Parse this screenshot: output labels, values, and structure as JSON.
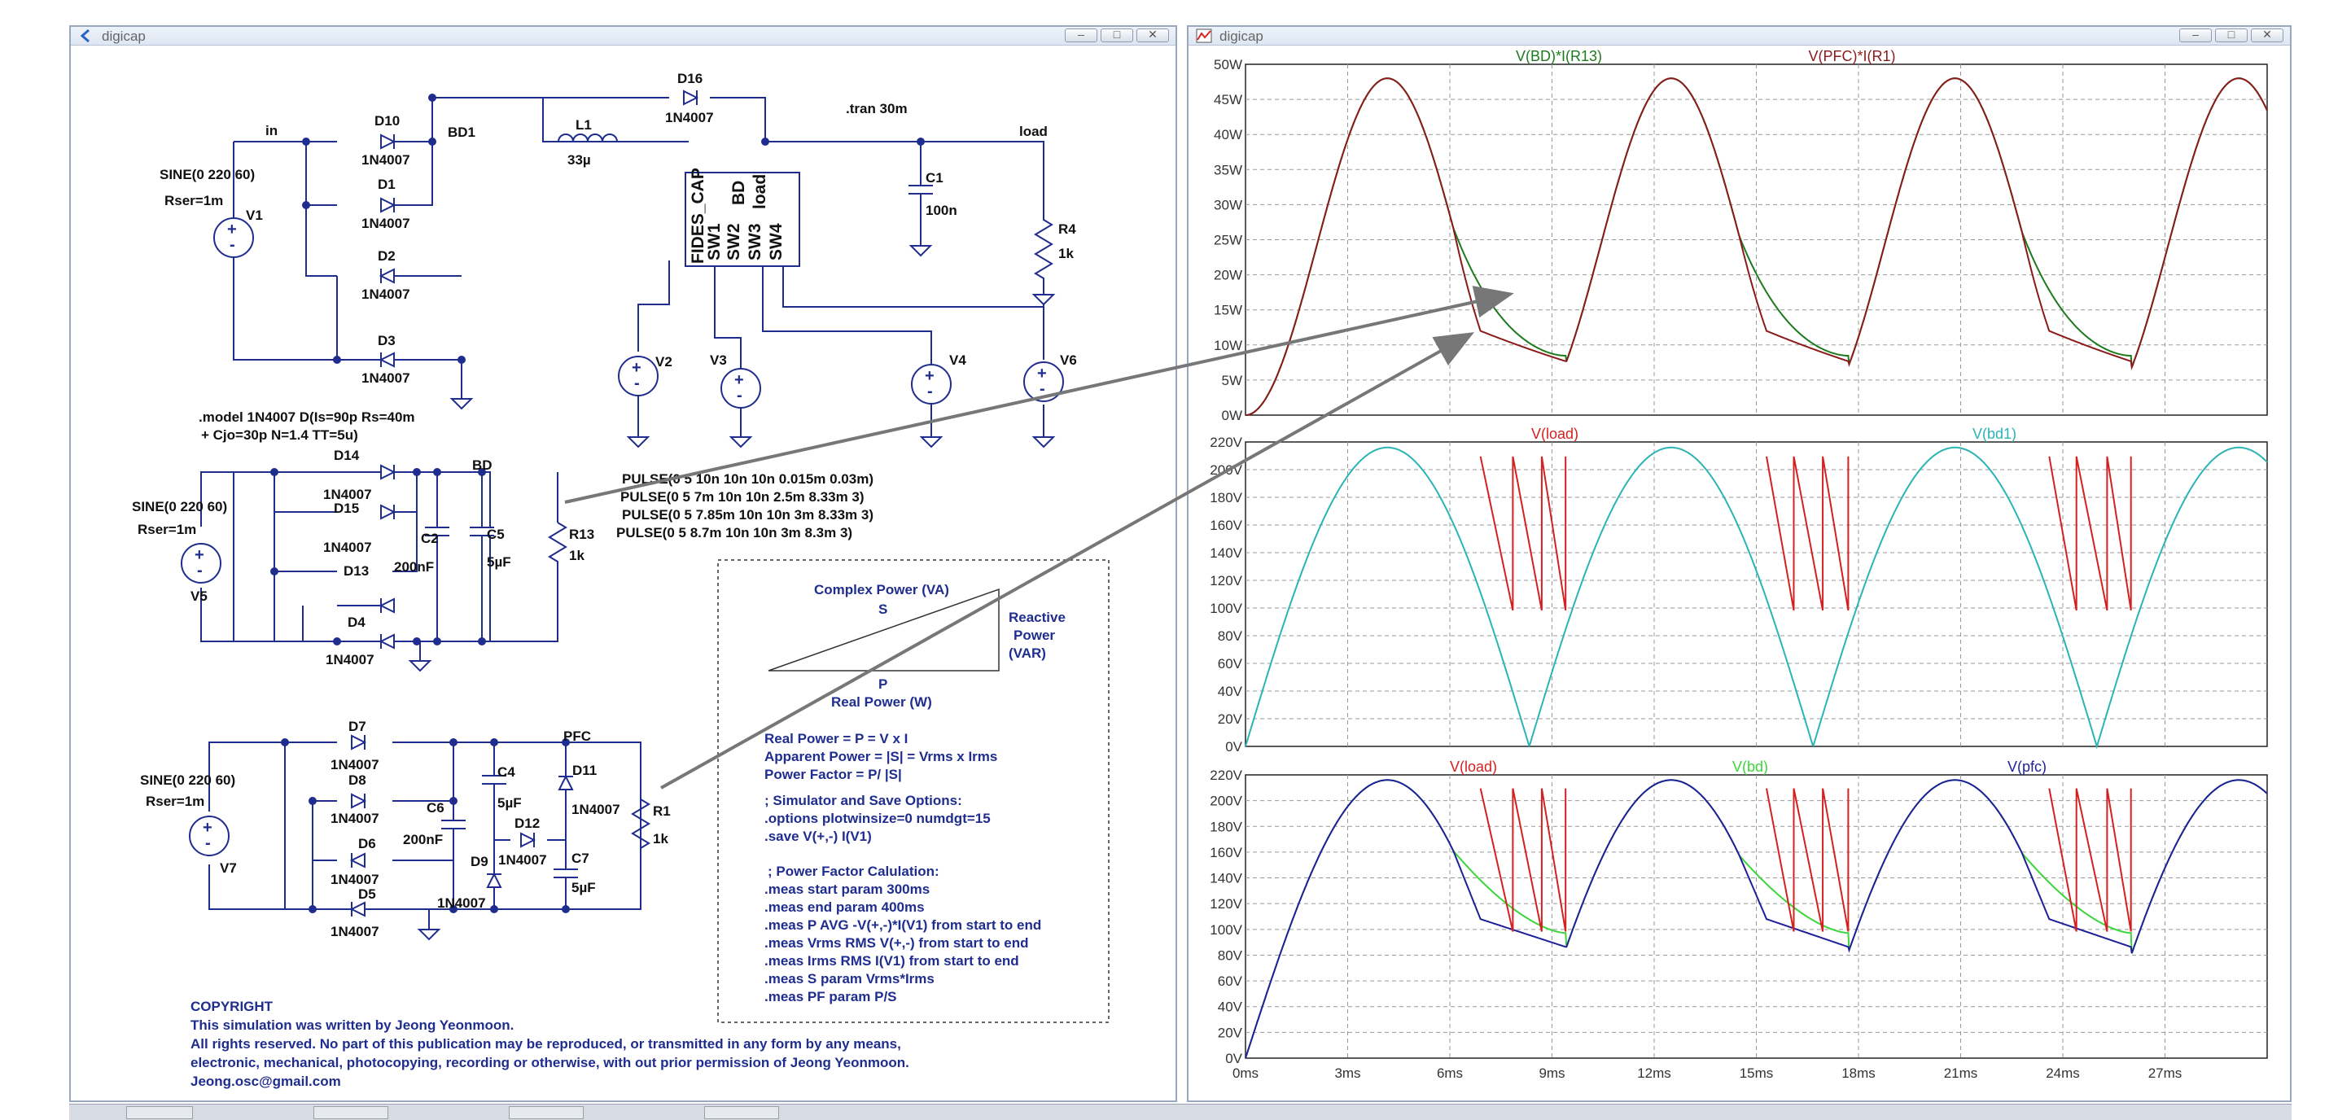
{
  "left_window": {
    "title": "digicap",
    "buttons": [
      "minimize-button",
      "maximize-button",
      "close-button"
    ],
    "schematic": {
      "net_labels": {
        "in": "in",
        "bd1": "BD1",
        "load": "load",
        "bd": "BD",
        "pfc": "PFC"
      },
      "directive_tran": ".tran 30m",
      "source_top": {
        "spec": "SINE(0 220 60)",
        "rser": "Rser=1m",
        "name": "V1"
      },
      "source_mid": {
        "spec": "SINE(0 220 60)",
        "rser": "Rser=1m",
        "name": "V5"
      },
      "source_bot": {
        "spec": "SINE(0 220 60)",
        "rser": "Rser=1m",
        "name": "V7"
      },
      "diode_model": "1N4007",
      "diodes_top": [
        "D10",
        "D1",
        "D2",
        "D3",
        "D16"
      ],
      "diodes_mid": [
        "D14",
        "D15",
        "D13",
        "D4"
      ],
      "diodes_bot": [
        "D7",
        "D8",
        "D6",
        "D5",
        "D9",
        "D11",
        "D12"
      ],
      "inductor": {
        "name": "L1",
        "value": "33µ"
      },
      "c1": {
        "name": "C1",
        "value": "100n"
      },
      "r4": {
        "name": "R4",
        "value": "1k"
      },
      "c2": {
        "name": "C2",
        "value": "200nF"
      },
      "c5": {
        "name": "C5",
        "value": "5µF"
      },
      "r13": {
        "name": "R13",
        "value": "1k"
      },
      "c6": {
        "name": "C6",
        "value": "200nF"
      },
      "c4": {
        "name": "C4",
        "value": "5µF"
      },
      "c7": {
        "name": "C7",
        "value": "5µF"
      },
      "r1": {
        "name": "R1",
        "value": "1k"
      },
      "ic": {
        "name": "FIDES_CAP",
        "pins": [
          "BD",
          "load",
          "SW1",
          "SW2",
          "SW3",
          "SW4"
        ]
      },
      "pulse_sources": [
        "V2",
        "V3",
        "V4",
        "V6"
      ],
      "model_line1": ".model 1N4007 D(Is=90p Rs=40m",
      "model_line2": "+ Cjo=30p N=1.4 TT=5u)",
      "pulse_lines": [
        "PULSE(0 5 10n 10n 10n 0.015m 0.03m)",
        "PULSE(0 5 7m 10n 10n 2.5m 8.33m 3)",
        "PULSE(0 5 7.85m 10n 10n 3m 8.33m 3)",
        "PULSE(0 5 8.7m 10n 10n 3m 8.3m 3)"
      ]
    },
    "power_box": {
      "complex_power": "Complex Power (VA)",
      "s": "S",
      "reactive": [
        "Reactive",
        "Power",
        "(VAR)"
      ],
      "p": "P",
      "real_power": "Real Power (W)",
      "formulas": [
        "Real Power = P = V x I",
        "Apparent Power = |S| = Vrms x Irms",
        "Power Factor = P/ |S|"
      ],
      "options": [
        "; Simulator and Save Options:",
        ".options plotwinsize=0 numdgt=15",
        ".save V(+,-) I(V1)"
      ],
      "meas": [
        "; Power Factor Calulation:",
        ".meas start param 300ms",
        ".meas end param 400ms",
        ".meas P AVG -V(+,-)*I(V1) from start to end",
        ".meas Vrms RMS V(+,-) from start to end",
        ".meas Irms RMS I(V1) from start to end",
        ".meas S param Vrms*Irms",
        ".meas PF param P/S"
      ]
    },
    "copyright": [
      "COPYRIGHT",
      "This simulation was written by Jeong Yeonmoon.",
      "All rights reserved. No part of this publication may be reproduced, or transmitted in any form by any means,",
      " electronic, mechanical, photocopying, recording or otherwise, with out prior permission of Jeong Yeonmoon.",
      "Jeong.osc@gmail.com"
    ]
  },
  "right_window": {
    "title": "digicap",
    "buttons": [
      "minimize-button",
      "maximize-button",
      "close-button"
    ]
  },
  "colors": {
    "dark_red": "#8b1a1a",
    "green": "#1d7a1d",
    "red": "#d42020",
    "cyan": "#2bb4b4",
    "lime": "#3ad63a",
    "navy": "#1f1f9a",
    "schematic": "#1f2d8f"
  },
  "chart_data": [
    {
      "type": "line",
      "xlabel_ticks": [
        "0ms",
        "3ms",
        "6ms",
        "9ms",
        "12ms",
        "15ms",
        "18ms",
        "21ms",
        "24ms",
        "27ms"
      ],
      "xlim": [
        0,
        30
      ],
      "ylim": [
        0,
        50
      ],
      "yticks": [
        "0W",
        "5W",
        "10W",
        "15W",
        "20W",
        "25W",
        "30W",
        "35W",
        "40W",
        "45W",
        "50W"
      ],
      "series": [
        {
          "name": "V(BD)*I(R13)",
          "color": "#1d7a1d",
          "description_points_ms": [
            0,
            4.2,
            6.2,
            8.33,
            9.3,
            12.5,
            14.5,
            16.67,
            17.7,
            20.8,
            22.9,
            25,
            26
          ]
        },
        {
          "name": "V(PFC)*I(R1)",
          "color": "#8b1a1a"
        }
      ],
      "peak": 48,
      "grid": true
    },
    {
      "type": "line",
      "xlim": [
        0,
        30
      ],
      "ylim": [
        0,
        220
      ],
      "yticks": [
        "0V",
        "20V",
        "40V",
        "60V",
        "80V",
        "100V",
        "120V",
        "140V",
        "160V",
        "180V",
        "200V",
        "220V"
      ],
      "series": [
        {
          "name": "V(load)",
          "color": "#d42020"
        },
        {
          "name": "V(bd1)",
          "color": "#2bb4b4"
        }
      ],
      "peak": 216,
      "grid": true
    },
    {
      "type": "line",
      "xlim": [
        0,
        30
      ],
      "ylim": [
        0,
        220
      ],
      "yticks": [
        "0V",
        "20V",
        "40V",
        "60V",
        "80V",
        "100V",
        "120V",
        "140V",
        "160V",
        "180V",
        "200V",
        "220V"
      ],
      "series": [
        {
          "name": "V(load)",
          "color": "#d42020"
        },
        {
          "name": "V(bd)",
          "color": "#3ad63a"
        },
        {
          "name": "V(pfc)",
          "color": "#1f1f9a"
        }
      ],
      "peak": 216,
      "grid": true
    }
  ]
}
